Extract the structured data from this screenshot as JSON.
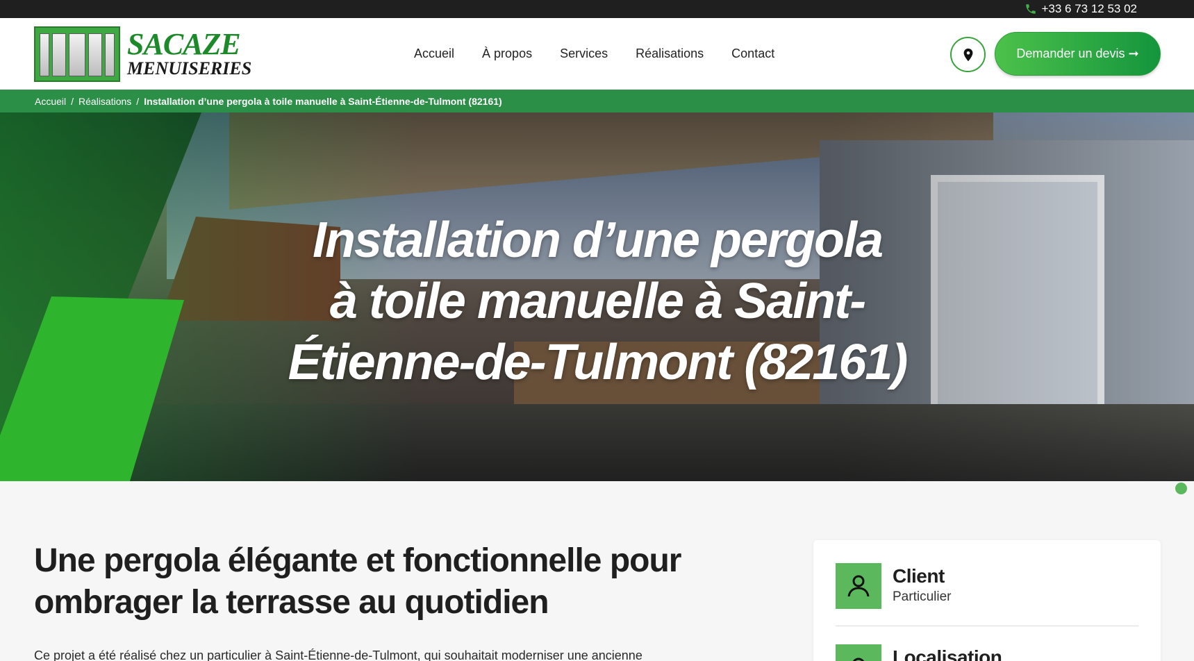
{
  "topbar": {
    "phone": "+33 6 73 12 53 02"
  },
  "logo": {
    "line1": "SACAZE",
    "line2": "MENUISERIES"
  },
  "nav": {
    "items": [
      "Accueil",
      "À propos",
      "Services",
      "Réalisations",
      "Contact"
    ]
  },
  "header": {
    "cta": "Demander un devis ➞"
  },
  "breadcrumb": {
    "home": "Accueil",
    "sep": "/",
    "parent": "Réalisations",
    "current": "Installation d’une pergola à toile manuelle à Saint-Étienne-de-Tulmont (82161)"
  },
  "hero": {
    "title_l1": "Installation d’une pergola",
    "title_l2": "à toile manuelle à Saint-",
    "title_l3": "Étienne-de-Tulmont (82161)"
  },
  "main": {
    "title_l1": "Une pergola élégante et fonctionnelle pour",
    "title_l2": "ombrager la terrasse au quotidien",
    "intro": "Ce projet a été réalisé chez un particulier à Saint-Étienne-de-Tulmont, qui souhaitait moderniser une ancienne"
  },
  "info_card": {
    "client_label": "Client",
    "client_value": "Particulier",
    "location_label": "Localisation"
  },
  "colors": {
    "accent": "#2b8f48",
    "cta": "#14953d",
    "slab": "#2eb52d",
    "icon_bg": "#5cb85c"
  }
}
